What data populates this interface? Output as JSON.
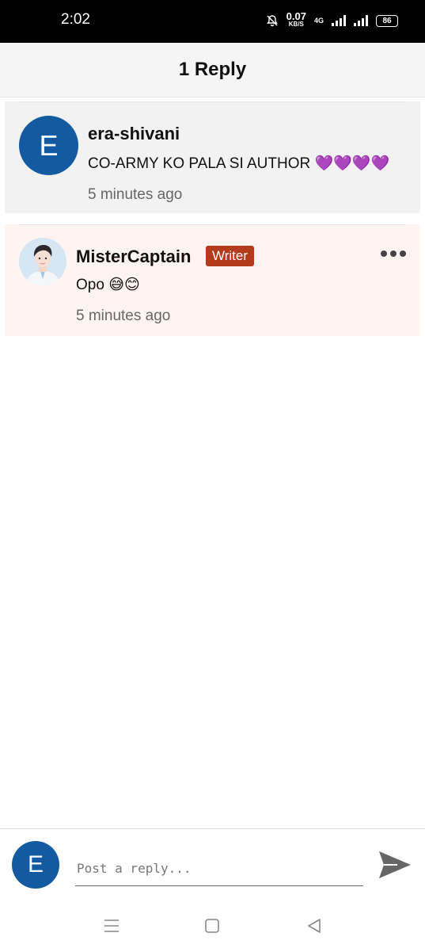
{
  "status": {
    "time": "2:02",
    "speed_value": "0.07",
    "speed_unit": "KB/S",
    "network": "4G",
    "battery": "86"
  },
  "header": {
    "title": "1 Reply"
  },
  "comment": {
    "avatar_letter": "E",
    "username": "era-shivani",
    "text": "CO-ARMY KO PALA SI AUTHOR 💜💜💜💜",
    "time": "5 minutes ago"
  },
  "reply": {
    "username": "MisterCaptain",
    "badge": "Writer",
    "text": "Opo 😅😊",
    "time": "5 minutes ago"
  },
  "composer": {
    "avatar_letter": "E",
    "placeholder": "Post a reply..."
  },
  "colors": {
    "avatar": "#135aa0",
    "badge": "#b33a1a",
    "reply_bg": "#fff4f1",
    "comment_bg": "#f2f2f2"
  }
}
